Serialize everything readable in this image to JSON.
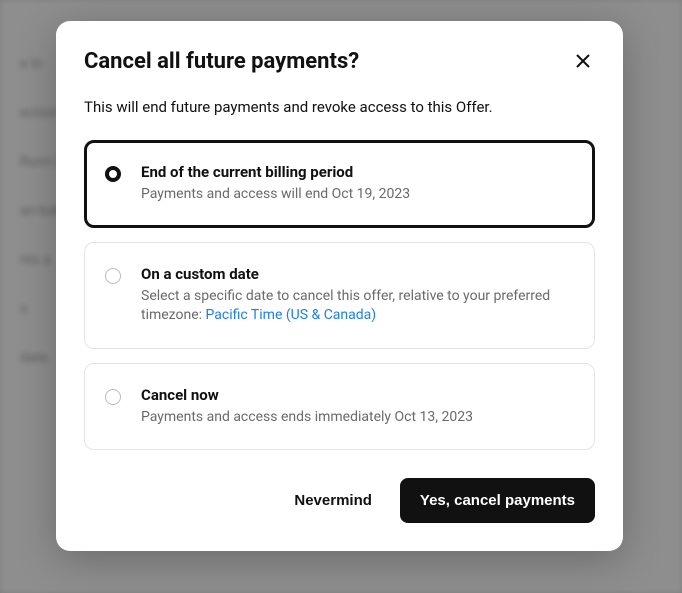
{
  "modal": {
    "title": "Cancel all future payments?",
    "subtitle": "This will end future payments and revoke access to this Offer.",
    "options": [
      {
        "title": "End of the current billing period",
        "desc": "Payments and access will end Oct 19, 2023"
      },
      {
        "title": "On a custom date",
        "desc_prefix": "Select a specific date to cancel this offer, relative to your preferred timezone: ",
        "tz_link": "Pacific Time (US & Canada)"
      },
      {
        "title": "Cancel now",
        "desc": "Payments and access ends immediately Oct 13, 2023"
      }
    ],
    "footer": {
      "secondary": "Nevermind",
      "primary": "Yes, cancel payments"
    }
  }
}
